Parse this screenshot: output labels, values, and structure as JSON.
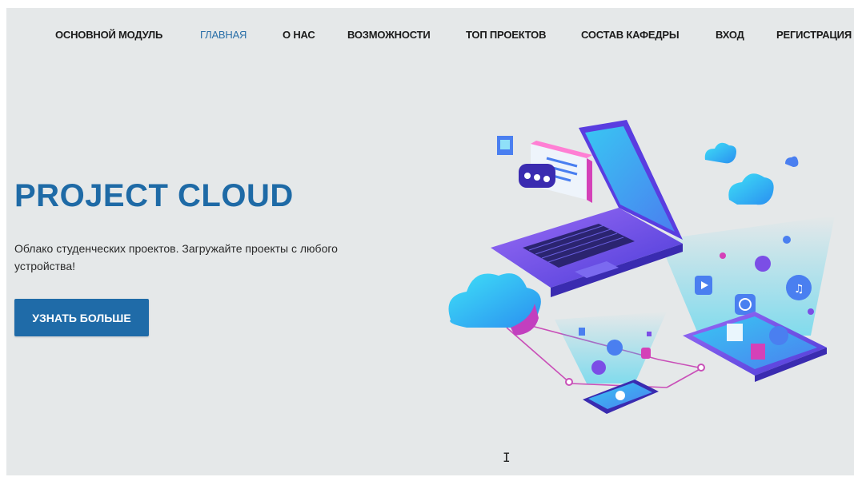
{
  "nav": {
    "items": [
      {
        "label": "ОСНОВНОЙ МОДУЛЬ"
      },
      {
        "label": "ГЛАВНАЯ",
        "active": true
      },
      {
        "label": "О НАС"
      },
      {
        "label": "ВОЗМОЖНОСТИ"
      },
      {
        "label": "ТОП ПРОЕКТОВ"
      },
      {
        "label": "СОСТАВ КАФЕДРЫ"
      },
      {
        "label": "ВХОД"
      },
      {
        "label": "РЕГИСТРАЦИЯ"
      }
    ]
  },
  "hero": {
    "title": "PROJECT CLOUD",
    "description": "Облако студенческих проектов. Загружайте проекты с любого устройства!",
    "cta_label": "УЗНАТЬ БОЛЬШЕ"
  },
  "colors": {
    "background": "#e5e8e9",
    "accent": "#1f6ba8",
    "nav_active": "#2a6fa8",
    "illustration_purple": "#7b4ee6",
    "illustration_cyan": "#21c8ee",
    "illustration_pink": "#d441b8"
  },
  "icons": {
    "illustration": "cloud-devices-illustration",
    "cursor": "text-cursor-icon"
  }
}
